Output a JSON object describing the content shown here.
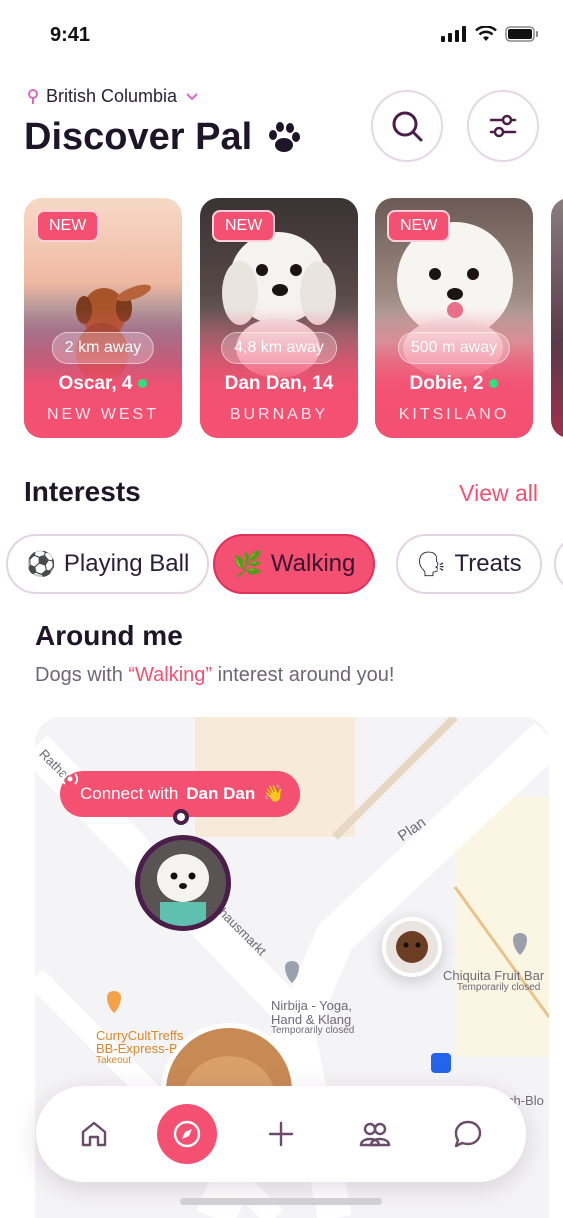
{
  "status": {
    "time": "9:41"
  },
  "header": {
    "location": "British Columbia",
    "title": "Discover Pal"
  },
  "cards": [
    {
      "badge": "NEW",
      "distance": "2 km away",
      "name": "Oscar, 4",
      "online": true,
      "area": "NEW WEST"
    },
    {
      "badge": "NEW",
      "distance": "4,8 km away",
      "name": "Dan Dan, 14",
      "online": false,
      "area": "BURNABY"
    },
    {
      "badge": "NEW",
      "distance": "500 m away",
      "name": "Dobie, 2",
      "online": true,
      "area": "KITSILANO"
    }
  ],
  "interests": {
    "title": "Interests",
    "view_all": "View all",
    "chips": [
      {
        "icon": "⚽",
        "label": "Playing Ball",
        "active": false
      },
      {
        "icon": "🌿",
        "label": "Walking",
        "active": true
      },
      {
        "icon": "🗣",
        "label": "Treats",
        "active": false
      }
    ]
  },
  "around": {
    "title": "Around me",
    "sub_before": "Dogs with ",
    "sub_highlight": "“Walking”",
    "sub_after": " interest around you!"
  },
  "map": {
    "connect_prefix": "Connect with",
    "connect_name": "Dan Dan",
    "connect_emoji": "👋",
    "labels": {
      "street1": "Rathausm",
      "street2": "Rathausmarkt",
      "plan": "Plan",
      "poi1": "Nirbija - Yoga,",
      "poi1b": "Hand & Klang",
      "poi1c": "Temporarily closed",
      "poi2": "Chiquita Fruit Bar",
      "poi2b": "Temporarily closed",
      "poi3": "CurryCultTreffs",
      "poi3b": "BB-Express-B",
      "poi3c": "Takeout",
      "poi4": "ch-Blo"
    }
  },
  "nav": {
    "items": [
      "home-icon",
      "explore-icon",
      "plus-icon",
      "friends-icon",
      "chat-icon"
    ],
    "active": 1
  },
  "colors": {
    "accent": "#f45072",
    "dark": "#4a1d4a",
    "ink": "#1e1628"
  }
}
